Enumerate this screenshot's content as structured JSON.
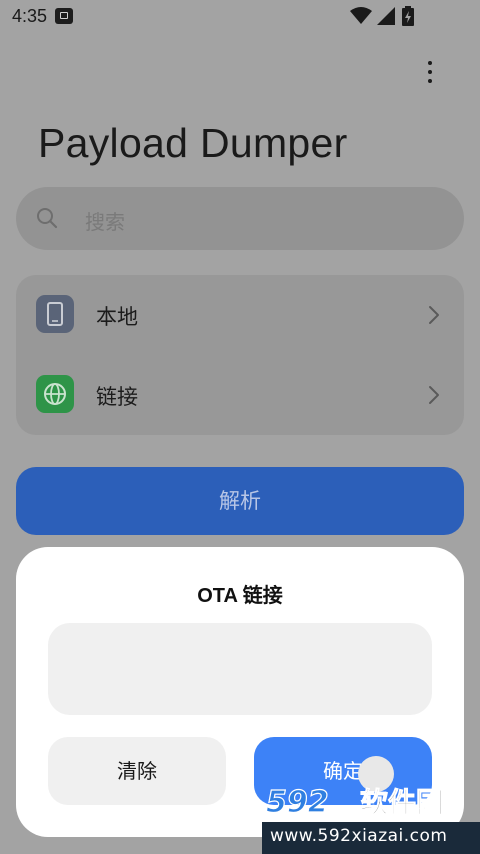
{
  "status_bar": {
    "time": "4:35",
    "icons": [
      "app-notification-icon",
      "wifi-icon",
      "signal-icon",
      "battery-charging-icon"
    ]
  },
  "app": {
    "title": "Payload Dumper",
    "menu_icon": "more-vert-icon",
    "search": {
      "placeholder": "搜索",
      "icon": "search-icon"
    },
    "sources": [
      {
        "label": "本地",
        "icon": "phone-icon",
        "color": "#5a6478"
      },
      {
        "label": "链接",
        "icon": "globe-icon",
        "color": "#2e9448"
      }
    ],
    "parse_button": "解析"
  },
  "dialog": {
    "title": "OTA 链接",
    "input_value": "",
    "clear_button": "清除",
    "confirm_button": "确定"
  },
  "watermark": {
    "brand": "592软件园",
    "url": "www.592xiazai.com"
  },
  "colors": {
    "accent": "#3d82f7",
    "parse_button": "#2c5fb9",
    "overlay_bg": "#a3a3a3"
  }
}
